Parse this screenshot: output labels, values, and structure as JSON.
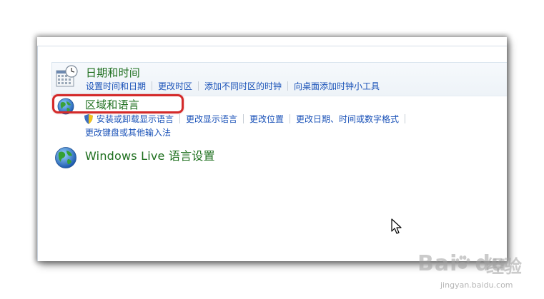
{
  "categories": [
    {
      "title": "日期和时间",
      "icon": "calendar-clock-icon",
      "links": [
        "设置时间和日期",
        "更改时区",
        "添加不同时区的时钟",
        "向桌面添加时钟小工具"
      ]
    },
    {
      "title": "区域和语言",
      "icon": "globe-icon",
      "links": [
        "安装或卸载显示语言",
        "更改显示语言",
        "更改位置",
        "更改日期、时间或数字格式",
        "更改键盘或其他输入法"
      ],
      "highlighted": true
    },
    {
      "title": "Windows Live 语言设置",
      "icon": "globe-icon"
    }
  ],
  "colors": {
    "title_green": "#1e6f1e",
    "link_blue": "#1a52b8",
    "highlight_red": "#d42a2a"
  },
  "watermark": {
    "brand": "Bai",
    "brand_suffix": "du",
    "text": "经验",
    "url": "jingyan.baidu.com"
  }
}
